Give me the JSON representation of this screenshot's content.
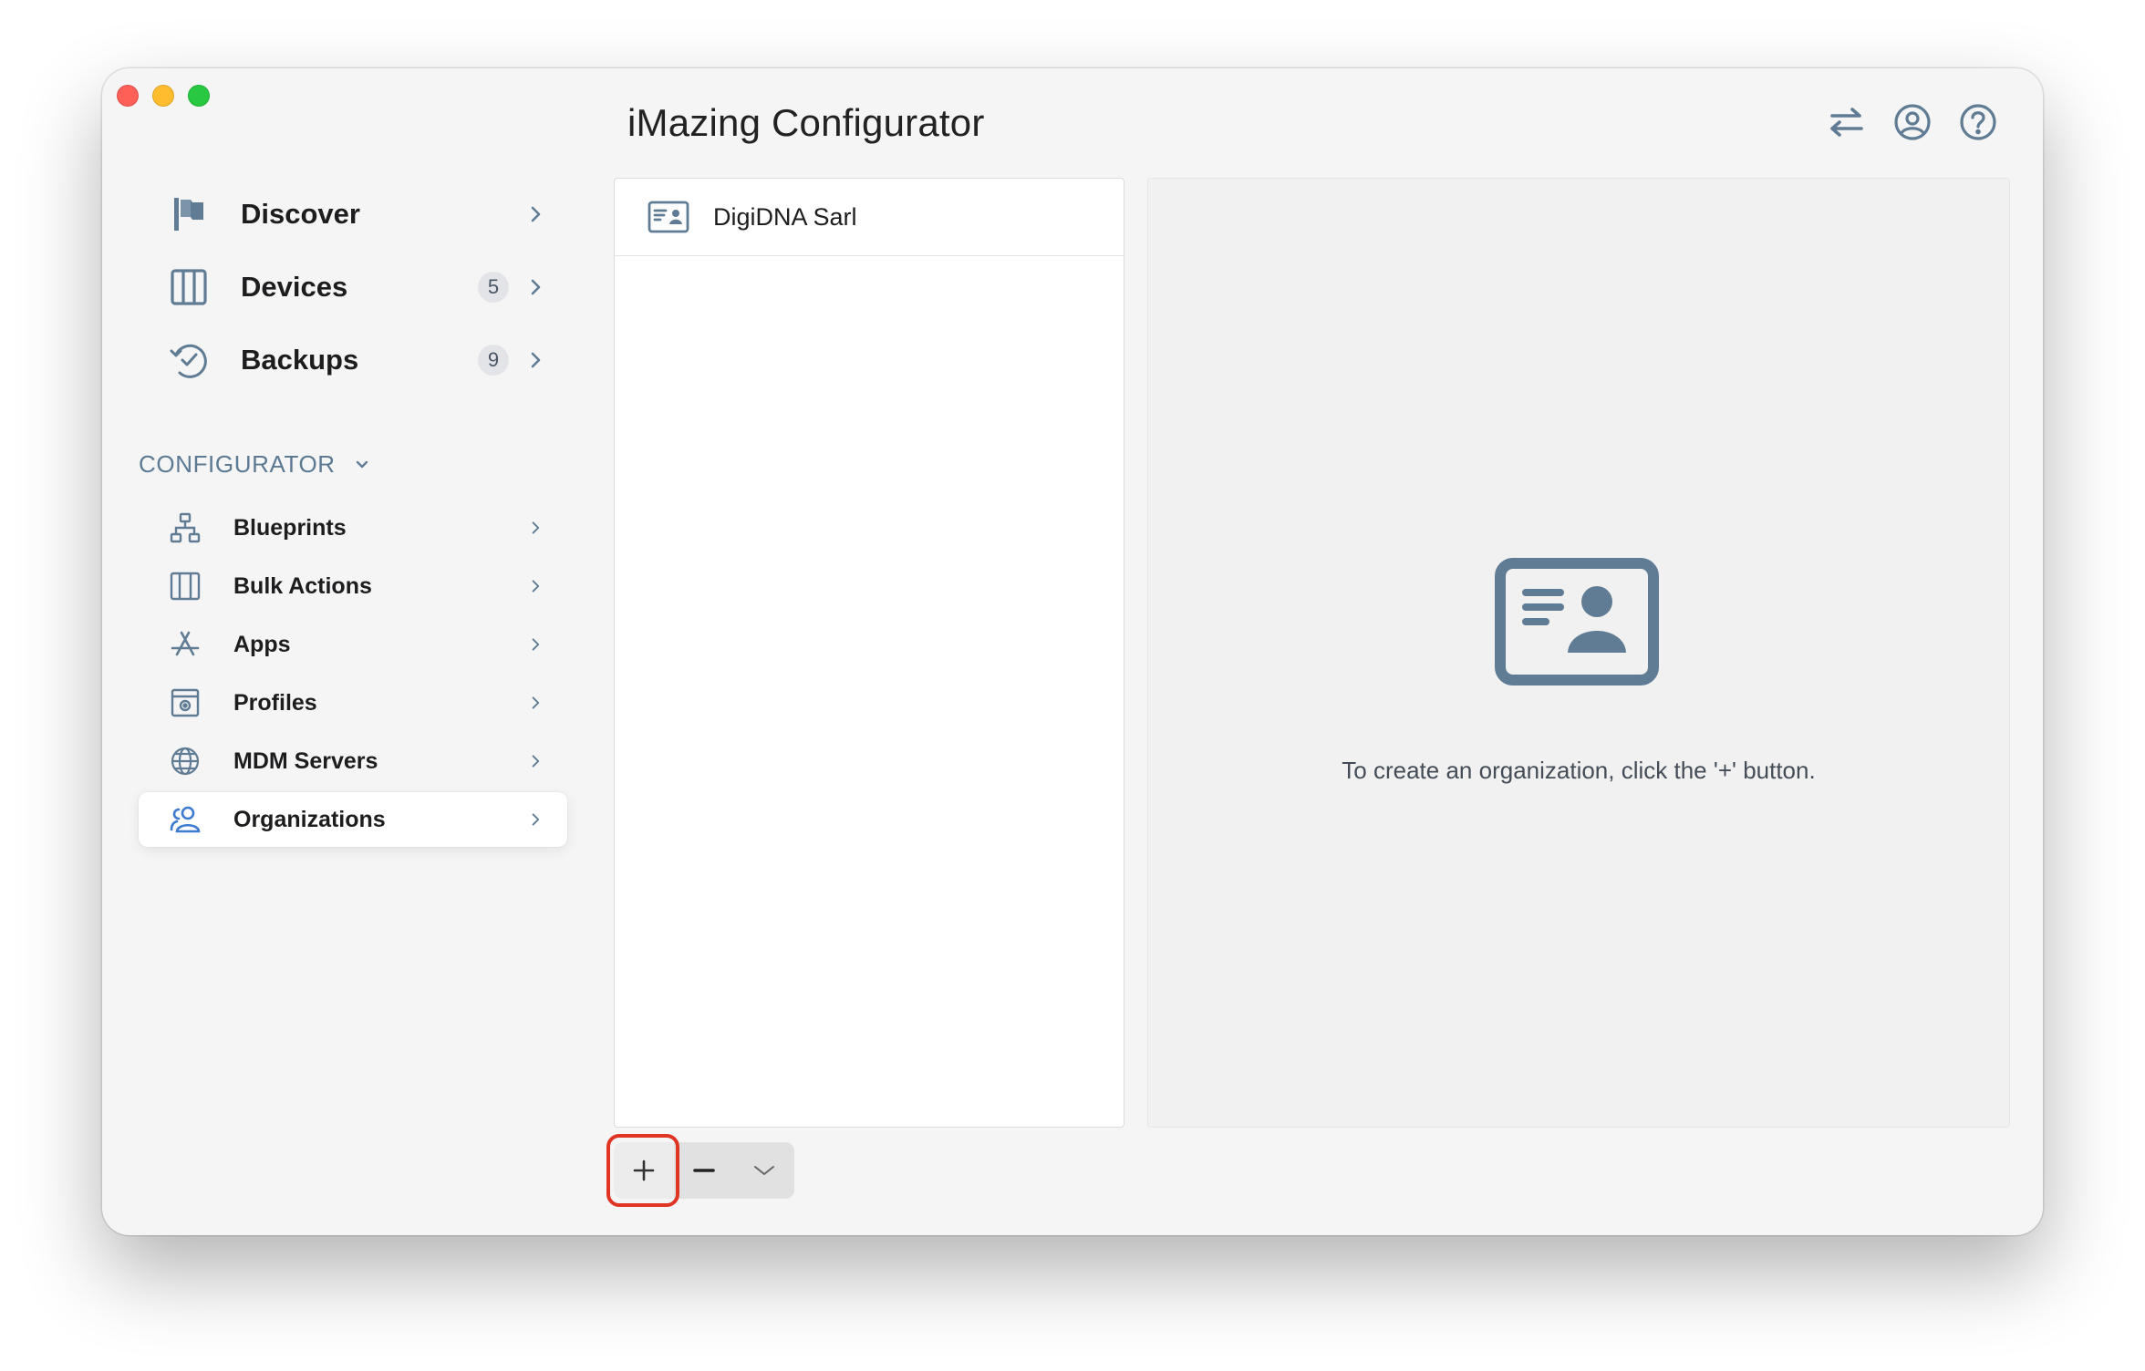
{
  "window": {
    "title": "iMazing Configurator"
  },
  "colors": {
    "accent": "#3d7bd0",
    "icon_gray": "#607c94",
    "highlight": "#e03523",
    "traffic_red": "#fe5f57",
    "traffic_yellow": "#febc2e",
    "traffic_green": "#28c840"
  },
  "toolbar": {
    "icons": [
      "transfer-icon",
      "account-icon",
      "help-icon"
    ]
  },
  "sidebar": {
    "main_items": [
      {
        "label": "Discover",
        "icon": "flag-icon"
      },
      {
        "label": "Devices",
        "icon": "devices-icon",
        "badge": "5"
      },
      {
        "label": "Backups",
        "icon": "backup-icon",
        "badge": "9"
      }
    ],
    "section": {
      "label": "CONFIGURATOR"
    },
    "config_items": [
      {
        "label": "Blueprints",
        "icon": "blueprint-icon"
      },
      {
        "label": "Bulk Actions",
        "icon": "bulk-actions-icon"
      },
      {
        "label": "Apps",
        "icon": "app-store-icon"
      },
      {
        "label": "Profiles",
        "icon": "profile-icon"
      },
      {
        "label": "MDM Servers",
        "icon": "globe-icon"
      },
      {
        "label": "Organizations",
        "icon": "people-icon",
        "selected": true
      }
    ]
  },
  "list": {
    "items": [
      {
        "label": "DigiDNA Sarl",
        "icon": "id-card-icon"
      }
    ]
  },
  "detail": {
    "message": "To create an organization, click the '+' button.",
    "icon": "id-card-icon"
  },
  "controls": {
    "buttons": [
      "plus-icon",
      "minus-icon",
      "chevron-down-icon"
    ]
  }
}
